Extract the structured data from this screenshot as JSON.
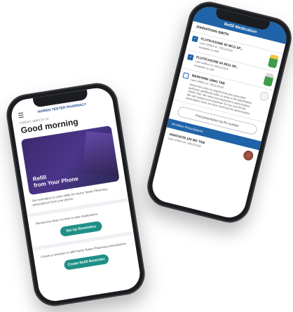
{
  "right_phone": {
    "header_title": "Refill Medication",
    "patient_name": "JOHNATHAN SMITH",
    "medications": [
      {
        "name": "FLUTICASONE 50 MCG SP...",
        "last_refilled": "Last refilled on: 05/11/2019",
        "status": "Available to refill",
        "checked": true,
        "image": "inhaler"
      },
      {
        "name": "FLUTICASONE 50 MCG SP...",
        "last_refilled": "Last refilled on: 05/11/2019",
        "status": "Available to refill",
        "checked": true,
        "image": "inhaler"
      },
      {
        "name": "WARFARIN 10MG TAB",
        "last_refilled": "Last refilled on: 09/11/2018",
        "message": "Select this entry to request that your prescriber authorize additional refills, in order to fill WARFARIN 10MG TAB. We need your physician's authorization. We will contact your physician for you and fill this prescription once we have received the authorization.",
        "checked": false,
        "image": "pill"
      }
    ],
    "find_button": "Find prescription by Rx number",
    "section_title": "All Other Prescriptions",
    "other_med_name": "VANCOCIN 125 MG TAB",
    "other_med_refilled": "Last refilled on: 09/11/2018"
  },
  "left_phone": {
    "brand": "HARRIS TEETER PHARMACY",
    "date": "FRIDAY, MARCH 15",
    "greeting": "Good morning",
    "card_title": "Refill\nfrom Your Phone",
    "card_desc": "Get reminders to order refills for Harris Teeter Pharmacy prescriptions from your phone.",
    "reminder_text": "Remind me when it's time to take medications.",
    "reminder_button": "Set Up Reminders",
    "refill_text": "Create a reminder to refill Harris Teeter Pharmacy prescriptions.",
    "refill_button": "Create Refill Reminder"
  }
}
